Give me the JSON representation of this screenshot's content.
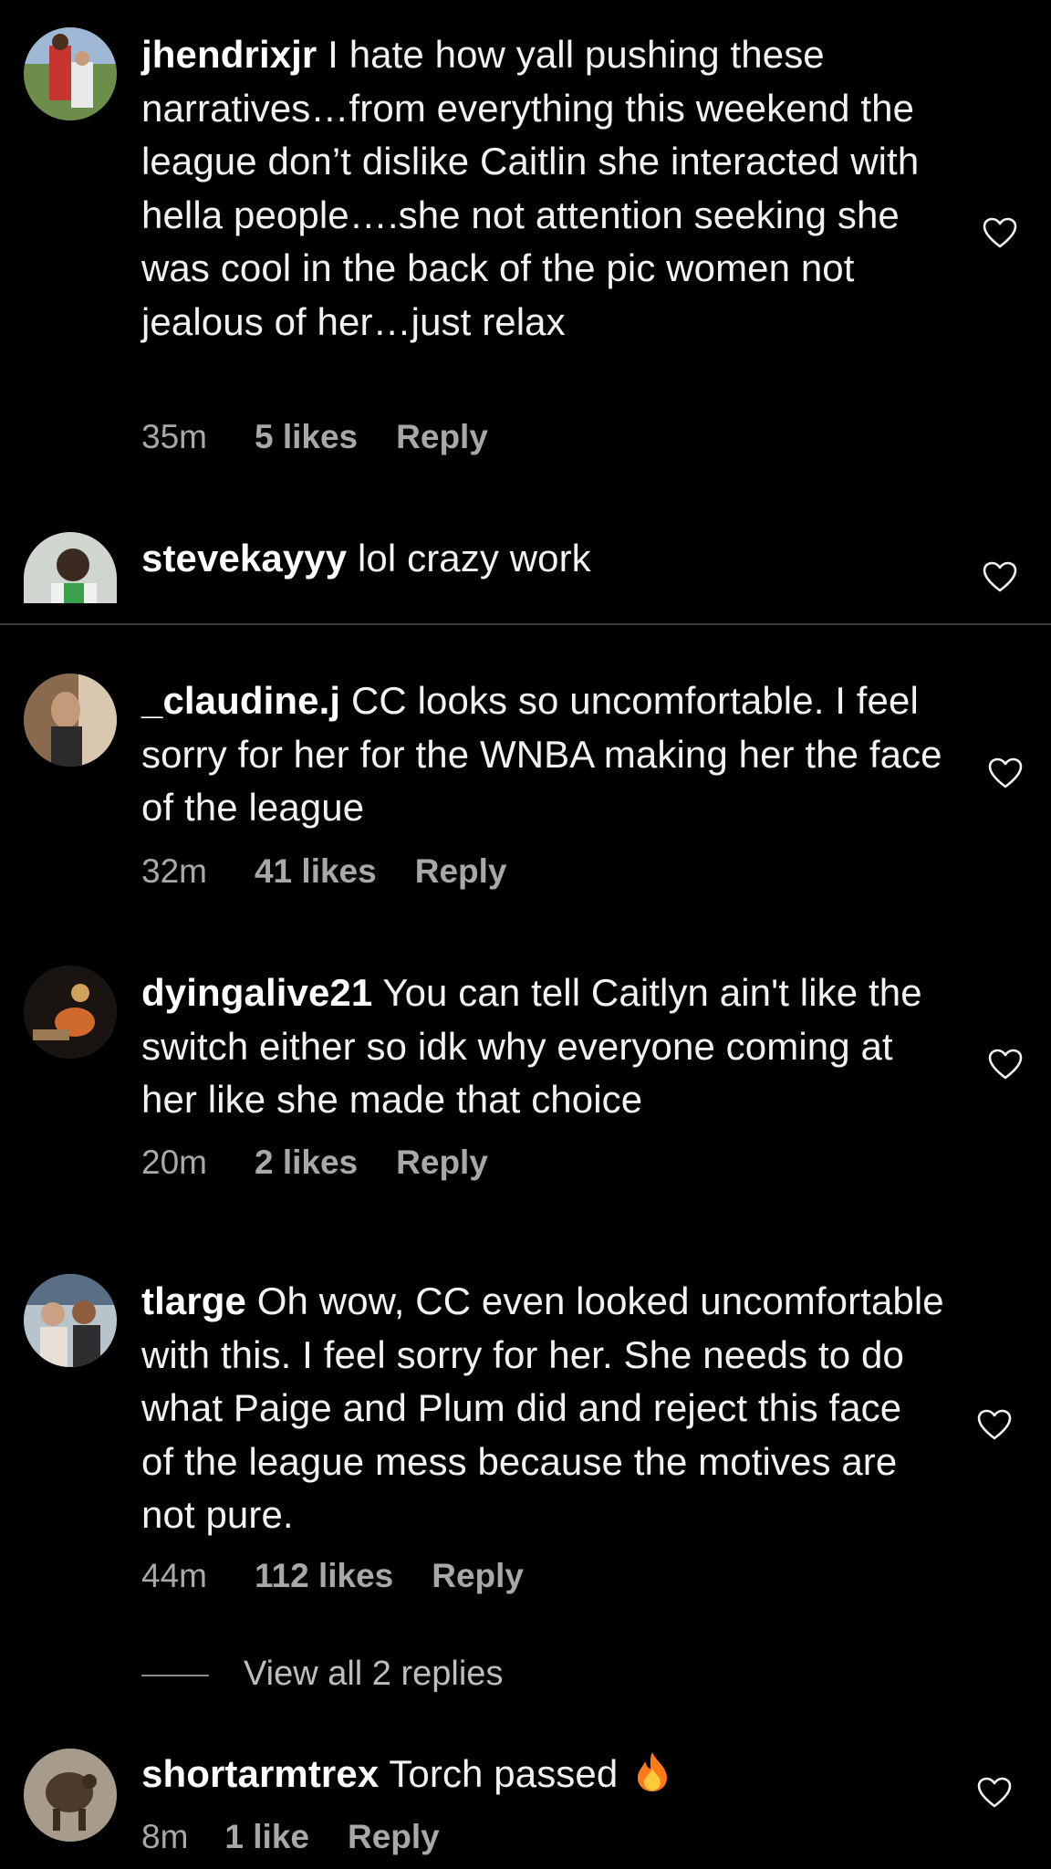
{
  "comments": [
    {
      "username": "jhendrixjr",
      "text": "I hate how yall pushing these narratives…from everything this weekend the league don’t dislike Caitlin she interacted with hella people….she not attention seeking she was cool in the back of the pic women not jealous of her…just relax",
      "time": "35m",
      "likes": "5 likes",
      "reply": "Reply"
    },
    {
      "username": "stevekayyy",
      "text": "lol crazy work"
    },
    {
      "username": "_claudine.j",
      "text": "CC looks so uncomfortable. I feel sorry for her for the WNBA making her the face of the league",
      "time": "32m",
      "likes": "41 likes",
      "reply": "Reply"
    },
    {
      "username": "dyingalive21",
      "text": "You can tell Caitlyn ain't like the switch either so idk why everyone coming at her like she made that choice",
      "time": "20m",
      "likes": "2 likes",
      "reply": "Reply"
    },
    {
      "username": "tlarge",
      "text": "Oh wow, CC even looked uncomfortable with this. I feel sorry for her. She needs to do what Paige and Plum did and reject this face of the league mess because the motives are not pure.",
      "time": "44m",
      "likes": "112 likes",
      "reply": "Reply",
      "view_replies": "View all 2 replies"
    },
    {
      "username": "shortarmtrex",
      "text": "Torch passed",
      "emoji": "🔥",
      "time": "8m",
      "likes": "1 like",
      "reply": "Reply"
    }
  ],
  "icons": {
    "like": "heart-outline-icon",
    "fire": "fire-emoji"
  },
  "colors": {
    "background": "#000000",
    "text": "#f2f2f2",
    "meta": "#a8a8a8",
    "divider": "#3a3a3a"
  }
}
